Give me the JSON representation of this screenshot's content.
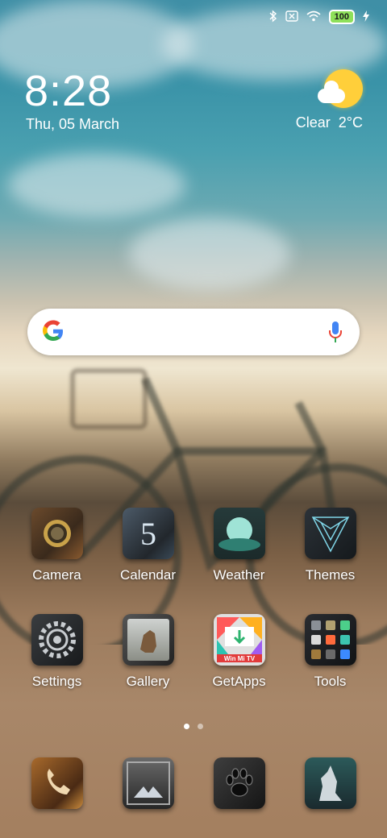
{
  "status_bar": {
    "icons": [
      "bluetooth-icon",
      "sim-blocked-icon",
      "wifi-icon",
      "battery-icon",
      "charging-icon"
    ],
    "battery_level": "100"
  },
  "clock": {
    "time": "8:28",
    "date": "Thu, 05 March"
  },
  "weather": {
    "condition": "Clear",
    "temperature": "2°C",
    "icon": "partly-sunny-icon"
  },
  "search": {
    "logo": "google-g-icon",
    "mic": "microphone-icon"
  },
  "apps": [
    {
      "label": "Camera",
      "icon": "camera-icon"
    },
    {
      "label": "Calendar",
      "icon": "calendar-icon"
    },
    {
      "label": "Weather",
      "icon": "weather-icon"
    },
    {
      "label": "Themes",
      "icon": "themes-icon"
    },
    {
      "label": "Settings",
      "icon": "settings-icon"
    },
    {
      "label": "Gallery",
      "icon": "gallery-icon"
    },
    {
      "label": "GetApps",
      "icon": "getapps-icon"
    },
    {
      "label": "Tools",
      "icon": "tools-folder-icon"
    }
  ],
  "calendar_day": "5",
  "getapps_badge": "Win Mi TV",
  "page_indicator": {
    "pages": 2,
    "current": 1
  },
  "dock": [
    {
      "icon": "phone-icon"
    },
    {
      "icon": "messages-icon"
    },
    {
      "icon": "paw-icon"
    },
    {
      "icon": "wolf-icon"
    }
  ],
  "colors": {
    "accent_green": "#8ee05a",
    "sun": "#ffcf3a"
  }
}
